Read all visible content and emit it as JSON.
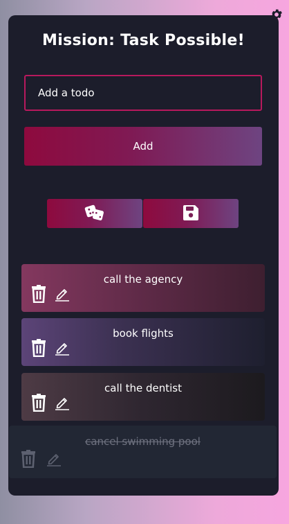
{
  "app": {
    "title": "Mission: Task Possible!"
  },
  "input": {
    "placeholder": "Add a todo",
    "value": ""
  },
  "buttons": {
    "add_label": "Add",
    "random_icon": "dice-icon",
    "save_icon": "floppy-disk-icon",
    "settings_icon": "gear-icon"
  },
  "todos": [
    {
      "text": "call the agency",
      "completed": false
    },
    {
      "text": "book flights",
      "completed": false
    },
    {
      "text": "call the dentist",
      "completed": false
    },
    {
      "text": "cancel swimming pool",
      "completed": true
    }
  ],
  "colors": {
    "accent": "#b8195d",
    "card_bg": "#1c1d2b",
    "button_gradient_start": "#8e0a3e",
    "button_gradient_end": "#6e4481"
  }
}
